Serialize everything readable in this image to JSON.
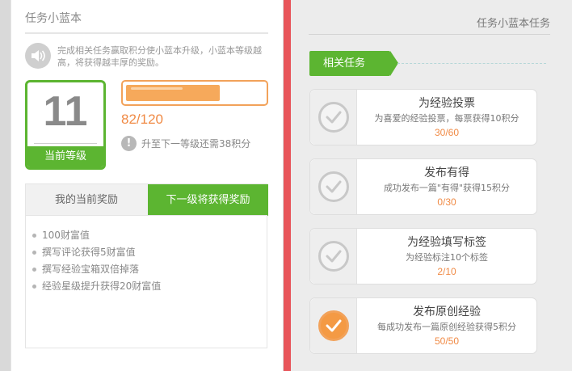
{
  "left": {
    "title": "任务小蓝本",
    "intro": "完成相关任务赢取积分使小蓝本升级，小蓝本等级越高，将获得越丰厚的奖励。",
    "level": {
      "number": "11",
      "label": "当前等级"
    },
    "progress": {
      "text": "82/120",
      "current": 82,
      "max": 120
    },
    "upgrade_hint": "升至下一等级还需38积分",
    "tabs": {
      "current": "我的当前奖励",
      "next": "下一级将获得奖励"
    },
    "rewards": [
      "100财富值",
      "撰写评论获得5财富值",
      "撰写经验宝箱双倍掉落",
      "经验星级提升获得20财富值"
    ]
  },
  "right": {
    "title": "任务小蓝本任务",
    "ribbon": "相关任务",
    "tasks": [
      {
        "title": "为经验投票",
        "desc": "为喜爱的经验投票，每票获得10积分",
        "count": "30/60",
        "done": false
      },
      {
        "title": "发布有得",
        "desc": "成功发布一篇\"有得\"获得15积分",
        "count": "0/30",
        "done": false
      },
      {
        "title": "为经验填写标签",
        "desc": "为经验标注10个标签",
        "count": "2/10",
        "done": false
      },
      {
        "title": "发布原创经验",
        "desc": "每成功发布一篇原创经验获得5积分",
        "count": "50/50",
        "done": true
      }
    ]
  },
  "colors": {
    "green": "#5cb531",
    "orange": "#f6a95b",
    "red_divider": "#e8555a"
  }
}
